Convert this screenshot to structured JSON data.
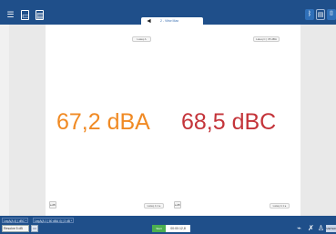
{
  "tab": {
    "label": "2 - Viêw Max",
    "back_arrow": "◄"
  },
  "top_left_icons": [
    "menu-icon",
    "clipboard-icon",
    "document-icon"
  ],
  "top_right_icons": [
    "bluetooth-icon",
    "document-icon",
    "camera-icon"
  ],
  "panel": {
    "top_left_button": "Lateq A",
    "top_right_button": "Lateq C | 35 dBA",
    "bottom_left_button": "Lateq A 1  ▸",
    "bottom_right_button": "Lateq A 1  ▸",
    "left_square_label": "▸dB",
    "right_square_label": "▸dB"
  },
  "readings": {
    "a": "67,2 dBA",
    "c": "68,5 dBC"
  },
  "bottom": {
    "tag1": "LeqA(A 4) | dBC *",
    "tag2": "LeqA(A 1 | 60 dBA 4) | 3 dB *",
    "input_value": "Resolve 5 dB",
    "small_btn": "▭",
    "green_btn": "Start",
    "time_value": "00:00:12,8",
    "meter_label": "METER"
  },
  "colors": {
    "header": "#1f4f8a",
    "dba": "#f08a24",
    "dbc": "#c4343a"
  }
}
